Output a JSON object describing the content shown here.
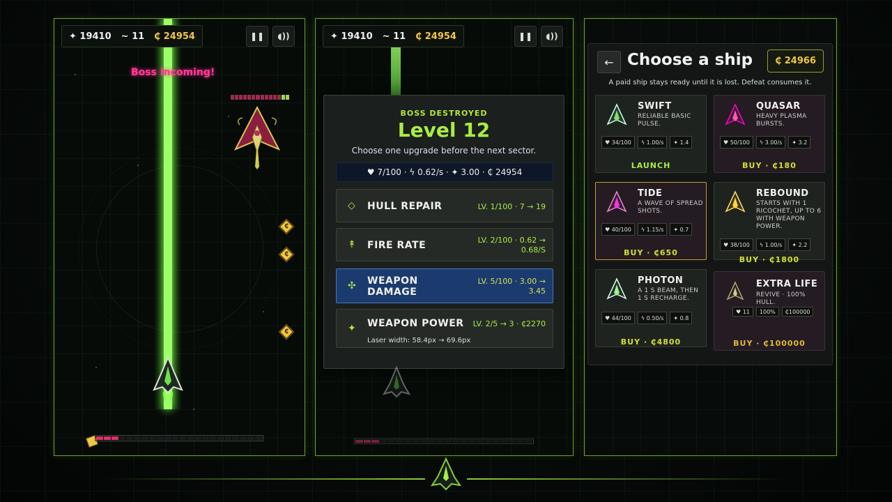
{
  "hud": {
    "score": "✦ 19410",
    "wave": "~ 11",
    "coins": "₵ 24954"
  },
  "panel1": {
    "boss_alert": "Boss incoming!",
    "boss_hp_fraction": 0.13,
    "sector_progress_fraction": 0.13
  },
  "panel2": {
    "kicker": "BOSS DESTROYED",
    "level": "Level 12",
    "subtitle": "Choose one upgrade before the next sector.",
    "stats": "♥ 7/100 · ϟ 0.62/s · ✦ 3.00 · ₵ 24954",
    "upgrades": [
      {
        "icon": "diamond-icon",
        "name": "HULL REPAIR",
        "level": "LV. 1/100 · 7 → 19"
      },
      {
        "icon": "arrow-up-icon",
        "name": "FIRE RATE",
        "level_line1": "LV. 2/100 · 0.62 →",
        "level_line2": "0.68/S"
      },
      {
        "icon": "crosshair-icon",
        "name_line1": "WEAPON",
        "name_line2": "DAMAGE",
        "level_line1": "LV. 5/100 · 3.00 →",
        "level_line2": "3.45"
      },
      {
        "icon": "star-icon",
        "name": "WEAPON POWER",
        "level": "LV. 2/5 → 3 · ₵2270",
        "note": "Laser width: 58.4px → 69.6px"
      }
    ]
  },
  "shop": {
    "back": "←",
    "title": "Choose a ship",
    "coins": "₵ 24966",
    "note": "A paid ship stays ready until it is lost. Defeat consumes it.",
    "ships": [
      {
        "name": "SWIFT",
        "desc": "RELIABLE BASIC PULSE.",
        "hp": "♥ 34/100",
        "rate": "ϟ 1.00/s",
        "dmg": "✦ 1.4",
        "action": "LAUNCH"
      },
      {
        "name": "QUASAR",
        "desc": "HEAVY PLASMA BURSTS.",
        "hp": "♥ 50/100",
        "rate": "ϟ 3.00/s",
        "dmg": "✦ 3.2",
        "action": "BUY · ₵180"
      },
      {
        "name": "TIDE",
        "desc": "A WAVE OF SPREAD SHOTS.",
        "hp": "♥ 40/100",
        "rate": "ϟ 1.15/s",
        "dmg": "✦ 0.7",
        "action": "BUY · ₵650"
      },
      {
        "name": "REBOUND",
        "desc": "STARTS WITH 1 RICOCHET, UP TO 6 WITH WEAPON POWER.",
        "hp": "♥ 38/100",
        "rate": "ϟ 1.00/s",
        "dmg": "✦ 2.2",
        "action": "BUY · ₵1800"
      },
      {
        "name": "PHOTON",
        "desc": "A 1 S BEAM, THEN 1 S RECHARGE.",
        "hp": "♥ 44/100",
        "rate": "ϟ 0.50/s",
        "dmg": "✦ 0.8",
        "action": "BUY · ₵4800"
      },
      {
        "name": "EXTRA LIFE",
        "desc": "REVIVE · 100% HULL.",
        "hp": "♥ 11",
        "rate": "100%",
        "dmg": "₵100000",
        "action": "BUY · ₵100000"
      }
    ]
  },
  "colors": {
    "accent": "#a9ec45",
    "coin": "#f2c744",
    "boss": "#ff3d9a",
    "selected": "#1b3b6e"
  }
}
